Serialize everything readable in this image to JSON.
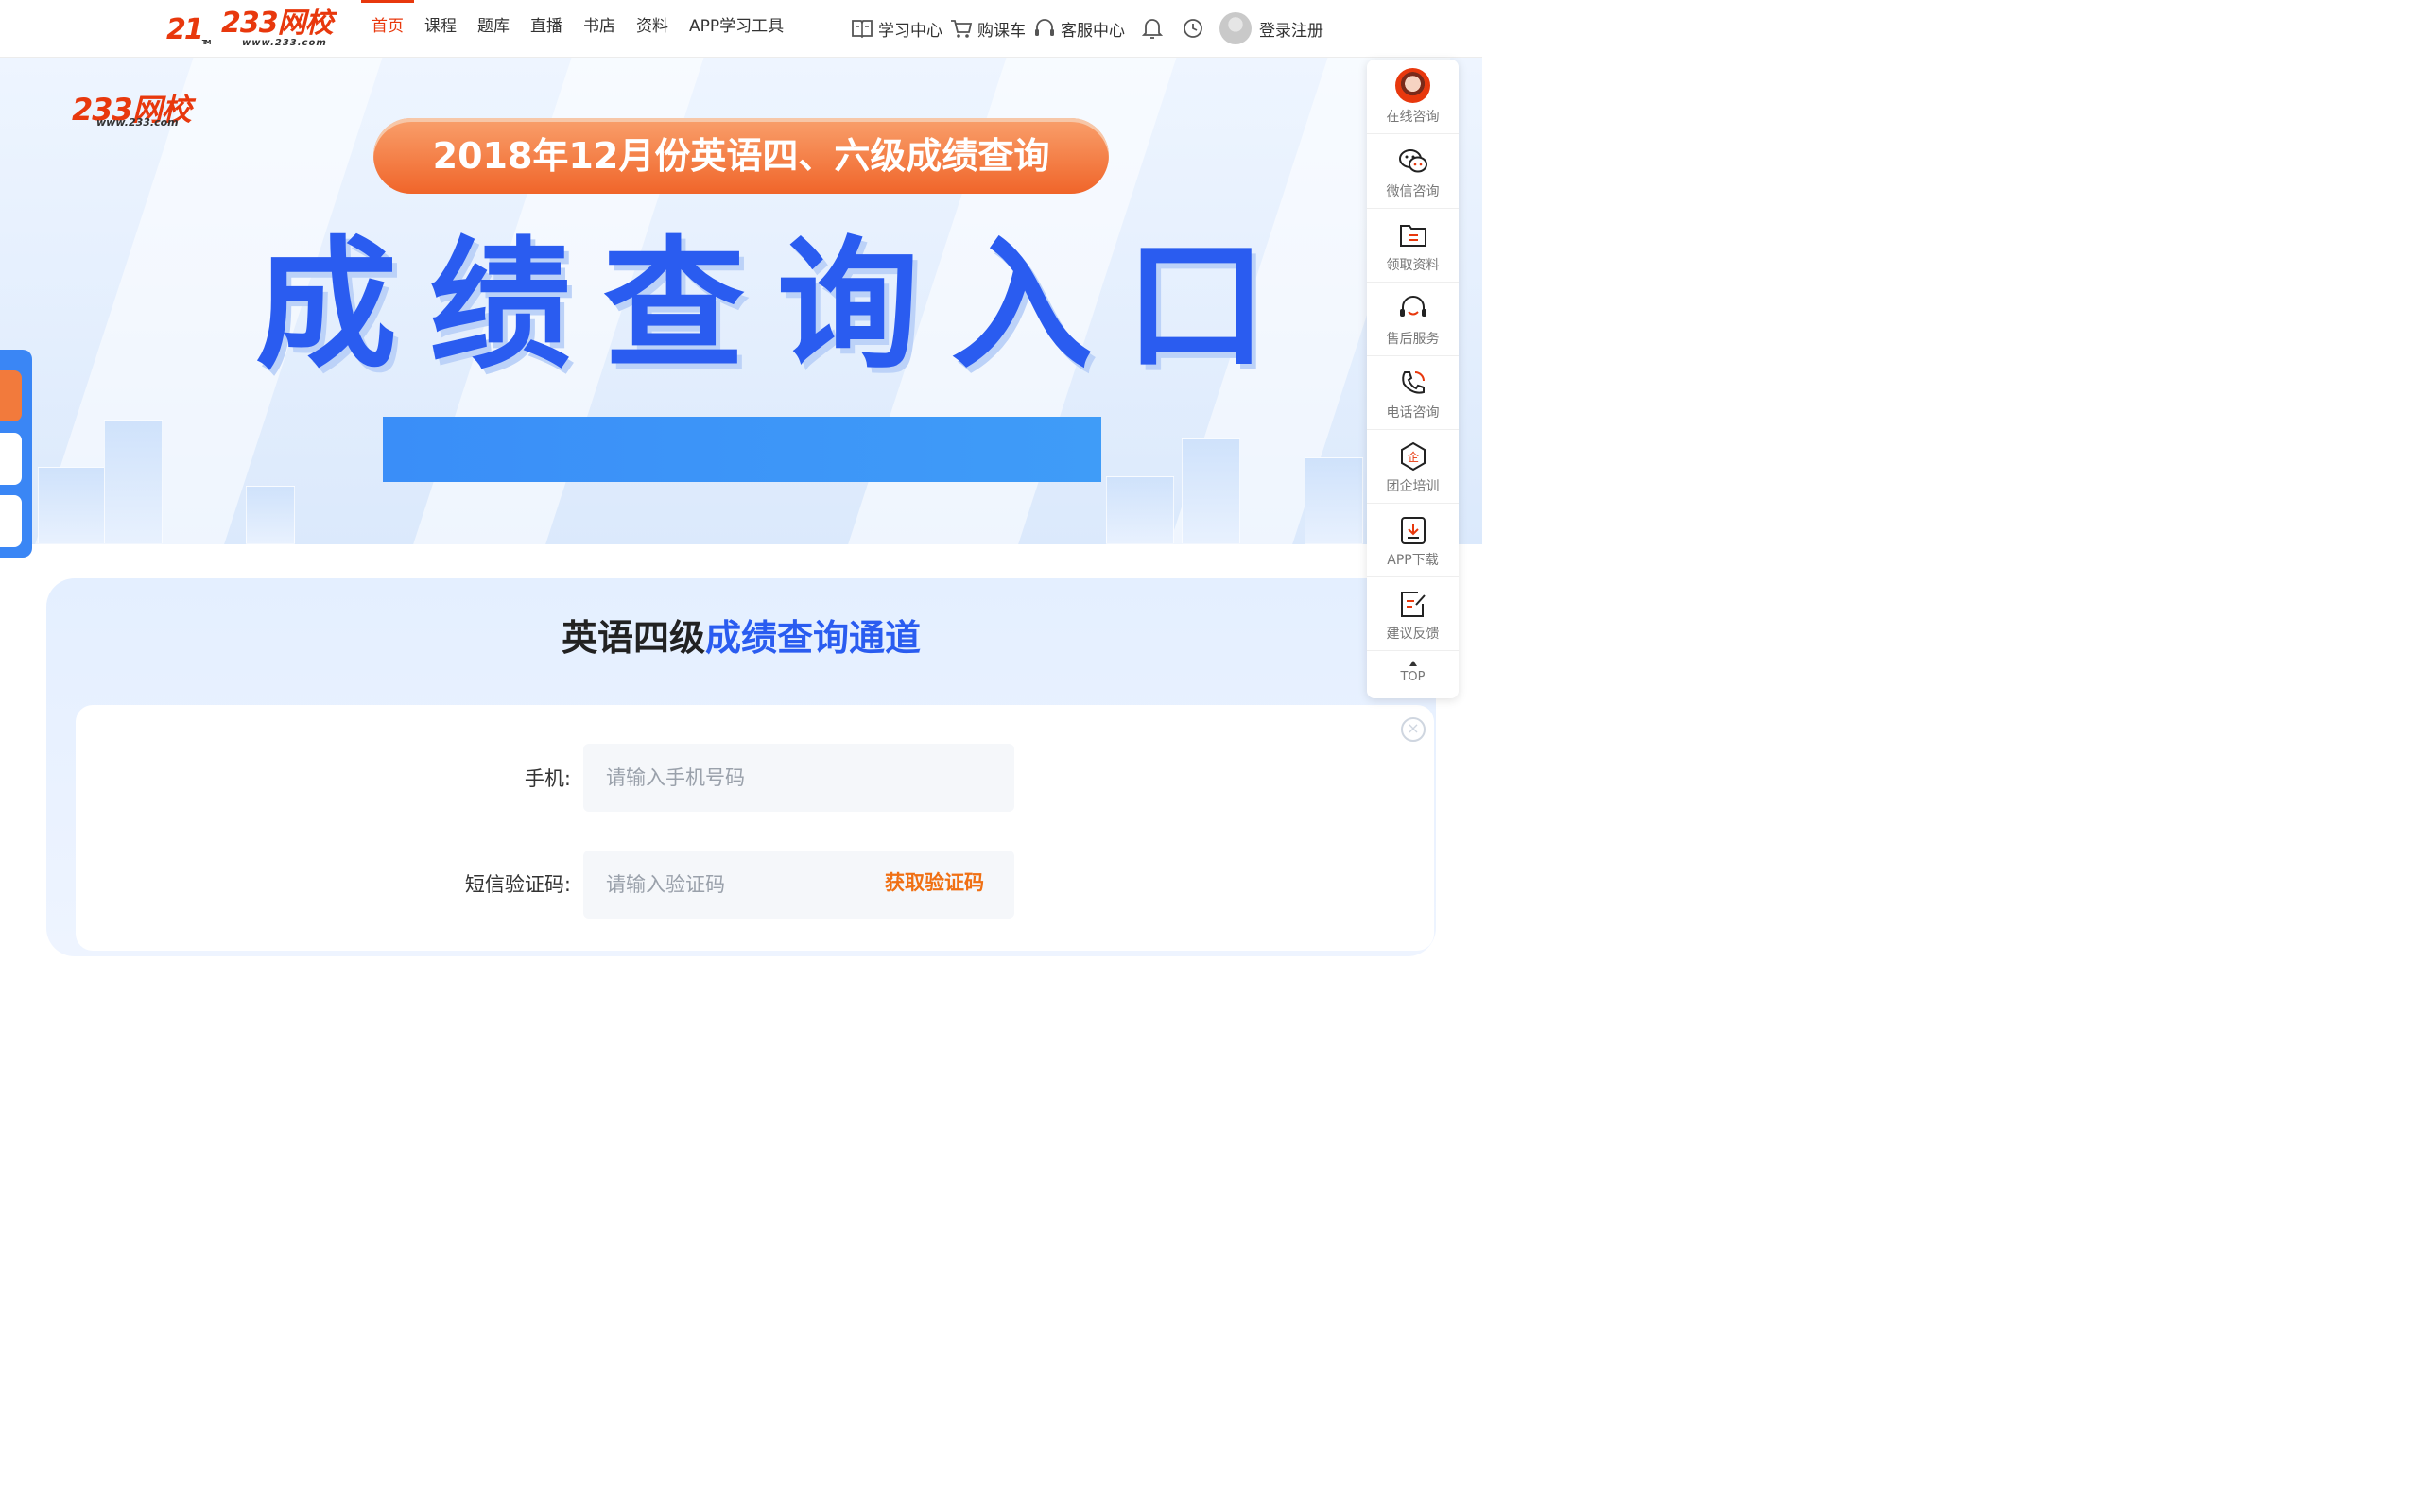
{
  "header": {
    "logo_21": "21",
    "logo_tm": "TM",
    "logo_brand": "233网校",
    "logo_url": "www.233.com",
    "nav": [
      {
        "label": "首页",
        "active": true
      },
      {
        "label": "课程"
      },
      {
        "label": "题库"
      },
      {
        "label": "直播"
      },
      {
        "label": "书店"
      },
      {
        "label": "资料"
      },
      {
        "label": "APP学习工具"
      }
    ],
    "tools": {
      "study_center": "学习中心",
      "cart": "购课车",
      "service": "客服中心",
      "login": "登录注册"
    }
  },
  "banner": {
    "logo_brand": "233网校",
    "logo_url": "www.233.com",
    "pill_text": "2018年12月份英语四、六级成绩查询",
    "big_title": "成绩查询入口"
  },
  "sidebar": {
    "items": [
      {
        "label": "在线咨询",
        "icon": "consultant-avatar"
      },
      {
        "label": "微信咨询",
        "icon": "wechat-icon"
      },
      {
        "label": "领取资料",
        "icon": "folder-icon"
      },
      {
        "label": "售后服务",
        "icon": "headset-icon"
      },
      {
        "label": "电话咨询",
        "icon": "phone-icon"
      },
      {
        "label": "团企培训",
        "icon": "enterprise-icon"
      },
      {
        "label": "APP下载",
        "icon": "download-icon"
      },
      {
        "label": "建议反馈",
        "icon": "feedback-icon"
      }
    ],
    "top_label": "TOP"
  },
  "query": {
    "title_prefix": "英语四级",
    "title_highlight": "成绩查询通道",
    "phone_label": "手机:",
    "phone_placeholder": "请输入手机号码",
    "code_label": "短信验证码:",
    "code_placeholder": "请输入验证码",
    "get_code": "获取验证码"
  },
  "colors": {
    "brand_red": "#e8380d",
    "accent_blue": "#2a5cf0",
    "orange": "#f07014"
  }
}
